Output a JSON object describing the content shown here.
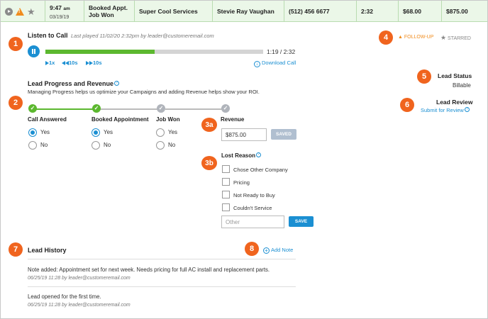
{
  "lead_row": {
    "time": "9:47",
    "ampm": "am",
    "date": "03/19/19",
    "status_line1": "Booked Appt.",
    "status_line2": "Job Won",
    "company": "Super Cool Services",
    "contact": "Stevie Ray Vaughan",
    "phone": "(512) 456 6677",
    "duration": "2:32",
    "revenue_small": "$68.00",
    "revenue_total": "$875.00"
  },
  "badges": [
    "1",
    "2",
    "3a",
    "3b",
    "4",
    "5",
    "6",
    "7",
    "8"
  ],
  "listen": {
    "title": "Listen to Call",
    "last_played": "Last played 11/02/20 2:32pm by leader@customeremail.com",
    "progress": 0.5,
    "time_display": "1:19 / 2:32",
    "speed": "1x",
    "rewind": "10s",
    "forward": "10s",
    "download": "Download Call"
  },
  "flags": {
    "follow_up": "FOLLOW-UP",
    "starred": "STARRED"
  },
  "lead_status": {
    "title": "Lead Status",
    "value": "Billable"
  },
  "lead_review": {
    "title": "Lead Review",
    "link": "Submit for Review"
  },
  "progress": {
    "title": "Lead Progress and Revenue",
    "description": "Managing Progress helps us optimize your Campaigns and adding Revenue helps show your ROI.",
    "steps": [
      {
        "label": "Call Answered",
        "done": true,
        "selected": "Yes"
      },
      {
        "label": "Booked Appointment",
        "done": true,
        "selected": "Yes"
      },
      {
        "label": "Job Won",
        "done": false,
        "selected": ""
      },
      {
        "label": "Revenue",
        "done": false
      }
    ],
    "yes": "Yes",
    "no": "No",
    "revenue_value": "$875.00",
    "saved_label": "SAVED"
  },
  "lost_reason": {
    "title": "Lost Reason",
    "options": [
      "Chose Other Company",
      "Pricing",
      "Not Ready to Buy",
      "Couldn't Service"
    ],
    "other_placeholder": "Other",
    "save_label": "SAVE"
  },
  "history": {
    "title": "Lead History",
    "add_note": "Add Note",
    "entries": [
      {
        "text": "Note added: Appointment set for next week. Needs pricing for full AC install and replacement parts.",
        "meta": "06/25/19 11:28 by leader@customeremail.com"
      },
      {
        "text": "Lead opened for the first time.",
        "meta": "06/25/19 11:28 by leader@customeremail.com"
      }
    ]
  },
  "colors": {
    "accent": "#1b8fd2",
    "badge": "#f0641e",
    "success": "#5cb82f",
    "warning": "#f08c1e"
  }
}
